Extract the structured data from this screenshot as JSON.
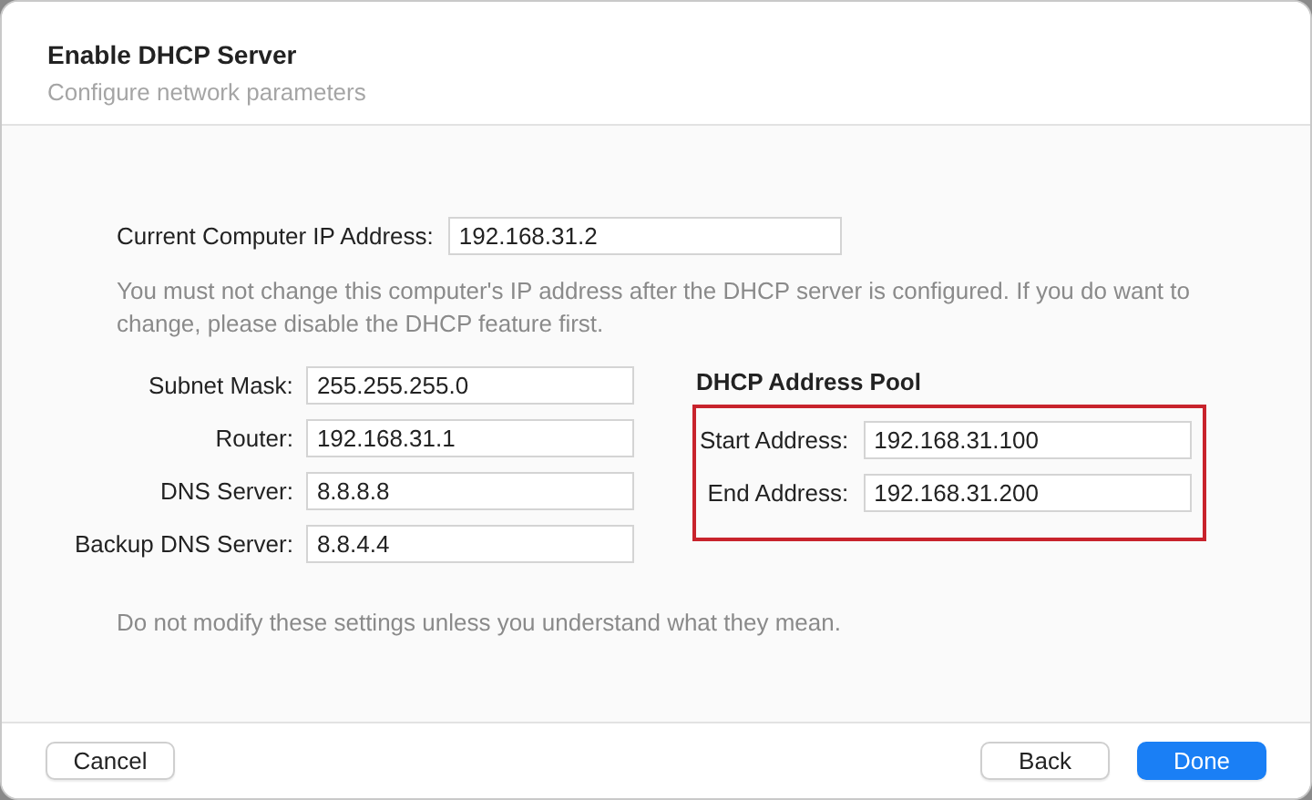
{
  "window": {
    "title": "Enable DHCP Server",
    "subtitle": "Configure network parameters"
  },
  "current_ip": {
    "label": "Current Computer IP Address:",
    "value": "192.168.31.2"
  },
  "warning": "You must not change this computer's IP address after the DHCP server is configured. If you do want to change, please disable the DHCP feature first.",
  "network_fields": [
    {
      "label": "Subnet Mask:",
      "value": "255.255.255.0"
    },
    {
      "label": "Router:",
      "value": "192.168.31.1"
    },
    {
      "label": "DNS Server:",
      "value": "8.8.8.8"
    },
    {
      "label": "Backup DNS Server:",
      "value": "8.8.4.4"
    }
  ],
  "address_pool": {
    "title": "DHCP Address Pool",
    "highlighted": true,
    "fields": [
      {
        "label": "Start Address:",
        "value": "192.168.31.100"
      },
      {
        "label": "End Address:",
        "value": "192.168.31.200"
      }
    ]
  },
  "note": "Do not modify these settings unless you understand what they mean.",
  "buttons": [
    {
      "label": "Cancel",
      "kind": "secondary"
    },
    {
      "label": "Back",
      "kind": "secondary"
    },
    {
      "label": "Done",
      "kind": "primary"
    }
  ]
}
